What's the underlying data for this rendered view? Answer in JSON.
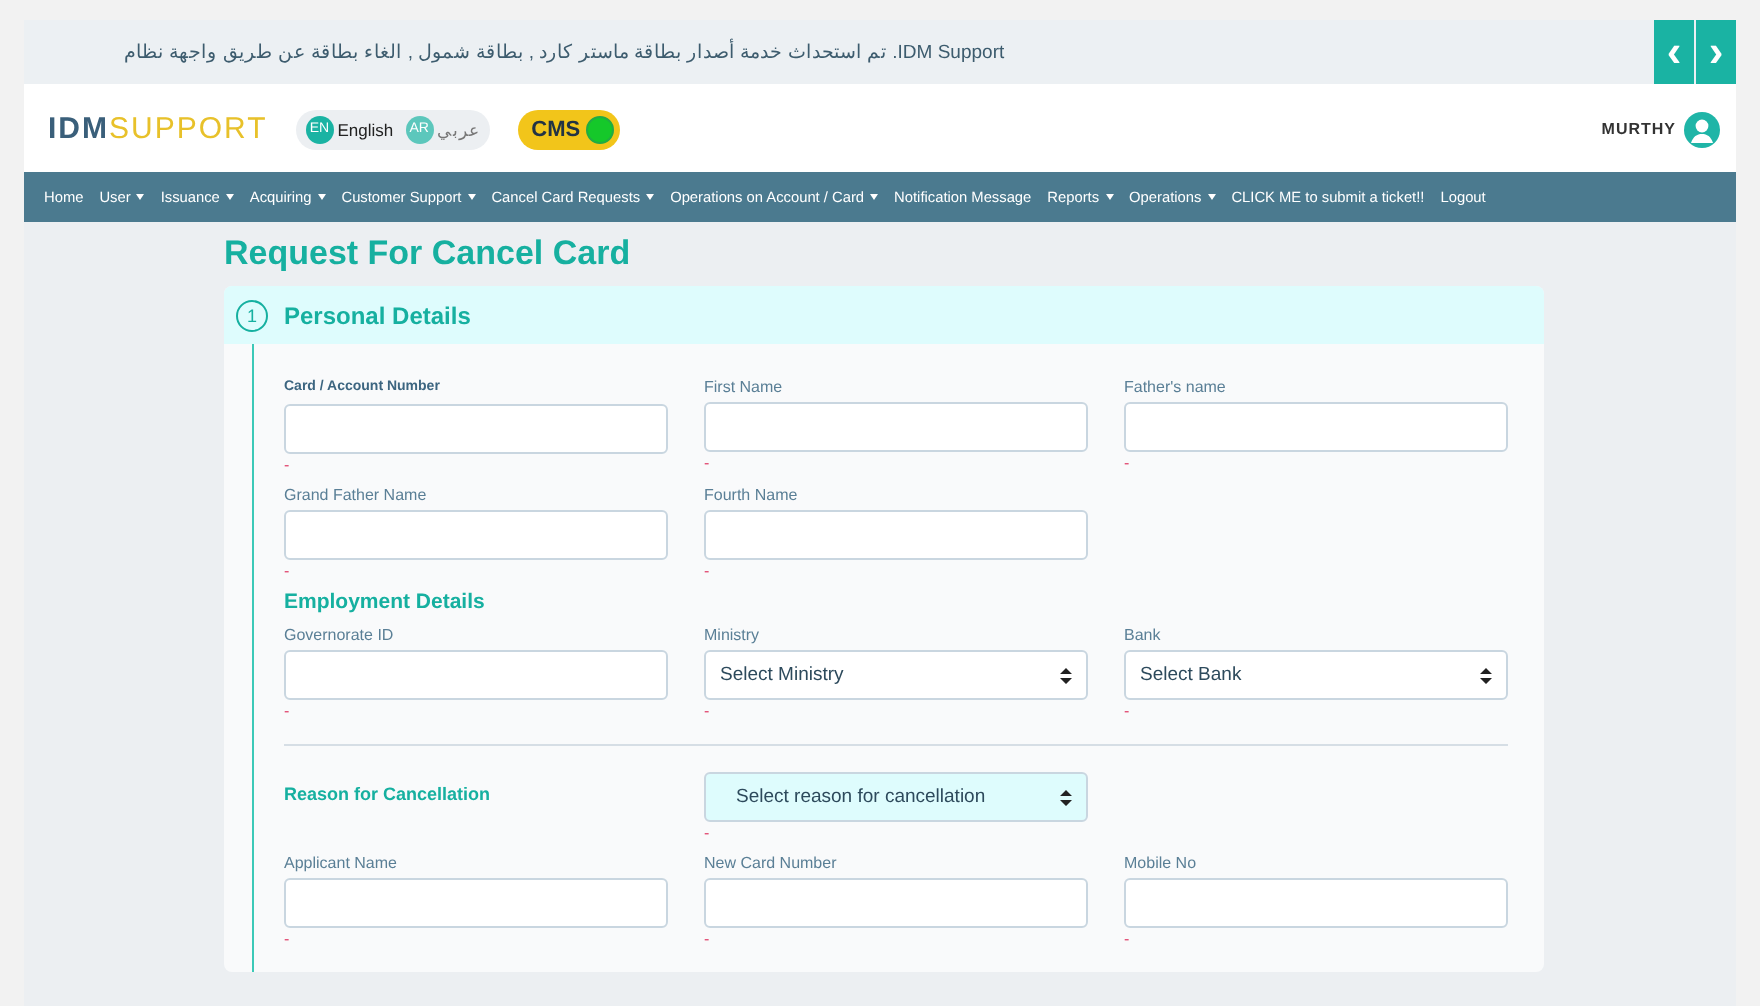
{
  "banner": {
    "text": "IDM Support. تم استحداث خدمة أصدار بطاقة ماستر كارد , بطاقة شمول , الغاء بطاقة عن طريق واجهة نظام",
    "buttons": [
      "‹",
      "›"
    ]
  },
  "header": {
    "logo_left": "IDM",
    "logo_right": "SUPPORT",
    "languages": [
      {
        "badge": "EN",
        "label": "English",
        "selected": true
      },
      {
        "badge": "AR",
        "label": "عربي",
        "selected": false
      }
    ],
    "cms": {
      "label": "CMS",
      "on": true
    },
    "user": "MURTHY"
  },
  "nav": [
    {
      "label": "Home",
      "dropdown": false
    },
    {
      "label": "User",
      "dropdown": true
    },
    {
      "label": "Issuance",
      "dropdown": true
    },
    {
      "label": "Acquiring",
      "dropdown": true
    },
    {
      "label": "Customer Support",
      "dropdown": true
    },
    {
      "label": "Cancel Card Requests",
      "dropdown": true
    },
    {
      "label": "Operations on Account / Card",
      "dropdown": true
    },
    {
      "label": "Notification Message",
      "dropdown": false
    },
    {
      "label": "Reports",
      "dropdown": true
    },
    {
      "label": "Operations",
      "dropdown": true
    },
    {
      "label": "CLICK ME to submit a ticket!!",
      "dropdown": false
    },
    {
      "label": "Logout",
      "dropdown": false
    }
  ],
  "page_title": "Request For Cancel Card",
  "section": {
    "step": "1",
    "title": "Personal Details",
    "blocks": [
      {
        "kind": "fields",
        "fields": [
          {
            "label": "Card / Account Number",
            "kind": "input",
            "strong": true,
            "error": "-"
          },
          {
            "label": "First Name",
            "kind": "input",
            "strong": false,
            "error": "-"
          },
          {
            "label": "Father's name",
            "kind": "input",
            "strong": false,
            "error": "-"
          },
          {
            "label": "Grand Father Name",
            "kind": "input",
            "strong": false,
            "error": "-"
          },
          {
            "label": "Fourth Name",
            "kind": "input",
            "strong": false,
            "error": "-"
          }
        ]
      },
      {
        "kind": "heading",
        "text": "Employment Details"
      },
      {
        "kind": "fields",
        "fields": [
          {
            "label": "Governorate ID",
            "kind": "input",
            "strong": false,
            "error": "-"
          },
          {
            "label": "Ministry",
            "kind": "select",
            "value": "Select Ministry",
            "strong": false,
            "error": "-"
          },
          {
            "label": "Bank",
            "kind": "select",
            "value": "Select Bank",
            "strong": false,
            "error": "-"
          }
        ]
      },
      {
        "kind": "rule"
      },
      {
        "kind": "reason",
        "text": "Reason for Cancellation",
        "value": "Select reason for cancellation",
        "error": "-"
      },
      {
        "kind": "fields",
        "fields": [
          {
            "label": "Applicant Name",
            "kind": "input",
            "strong": false,
            "error": "-"
          },
          {
            "label": "New Card Number",
            "kind": "input",
            "strong": false,
            "error": "-"
          },
          {
            "label": "Mobile No",
            "kind": "input",
            "strong": false,
            "error": "-"
          }
        ]
      }
    ]
  }
}
